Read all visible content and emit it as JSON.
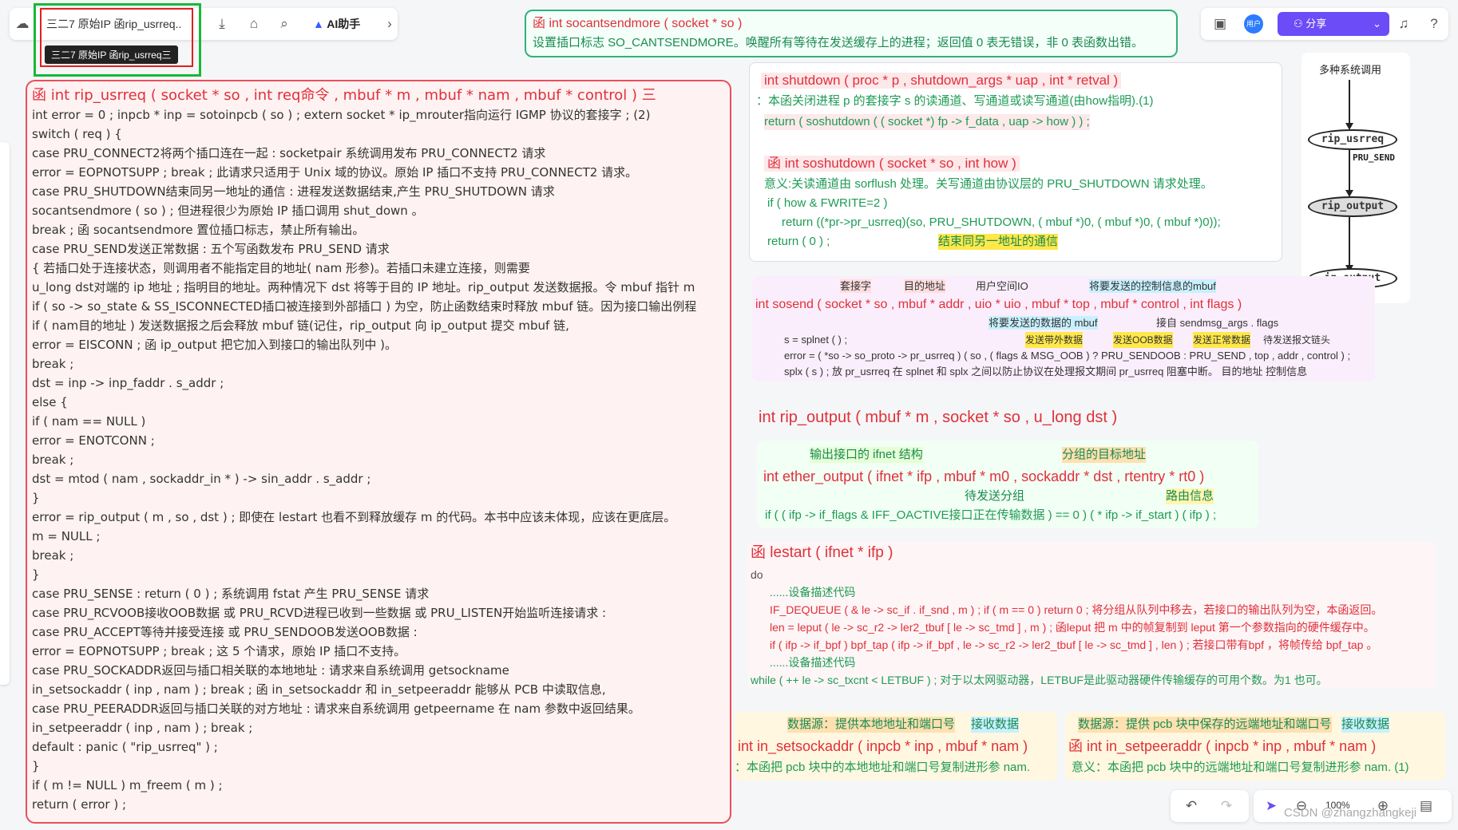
{
  "tab": {
    "title": "三二7 原始IP 函rip_usrreq..",
    "tooltip": "三二7 原始IP 函rip_usrreq三"
  },
  "toolbar": {
    "ai_label": "AI助手",
    "share_label": "分享",
    "user_label": "用户",
    "zoom": "100%"
  },
  "top_note": {
    "title": "函   int   socantsendmore ( socket * so )",
    "desc": "设置插口标志 SO_CANTSENDMORE。唤醒所有等待在发送缓存上的进程；返回值 0 表无错误，非 0 表函数出错。"
  },
  "left": {
    "lines": [
      "函     int   rip_usrreq ( socket * so , int  req命令 , mbuf *  m  , mbuf * nam , mbuf * control  )     三",
      "int error = 0 ;    inpcb * inp = sotoinpcb ( so ) ;    extern   socket *  ip_mrouter指向运行 IGMP 协议的套接字 ;    (2)",
      "switch ( req ) {",
      "case  PRU_CONNECT2将两个插口连在一起  :     socketpair 系统调用发布 PRU_CONNECT2 请求",
      "      error  =  EOPNOTSUPP ;        break ;     此请求只适用于 Unix 域的协议。原始 IP 插口不支持 PRU_CONNECT2 请求。",
      "case  PRU_SHUTDOWN结束同另一地址的通信  :      进程发送数据结束,产生 PRU_SHUTDOWN 请求",
      "      socantsendmore ( so ) ;                    但进程很少为原始 IP 插口调用 shut_down 。",
      "      break ;                                    函 socantsendmore 置位插口标志，禁止所有输出。",
      "case  PRU_SEND发送正常数据  :           五个写函数发布 PRU_SEND 请求",
      "   {                                           若插口处于连接状态，则调用者不能指定目的地址( nam 形参)。若插口未建立连接，则需要",
      "      u_long  dst对端的 ip 地址 ;                 指明目的地址。两种情况下 dst 将等于目的 IP 地址。rip_output 发送数据报。令 mbuf 指针 m",
      "      if ( so -> so_state  &  SS_ISCONNECTED插口被连接到外部插口 )       为空，防止函数结束时释放 mbuf 链。因为接口输出例程",
      "            if ( nam目的地址 )                 发送数据报之后会释放 mbuf 链(记住，rip_output 向 ip_output 提交 mbuf 链,",
      "                  error  =  EISCONN ;                                             函 ip_output 把它加入到接口的输出队列中 )。",
      "                  break ;",
      "            dst  =  inp -> inp_faddr . s_addr ;",
      "      else {",
      "            if ( nam  ==  NULL )",
      "                  error  =  ENOTCONN ;",
      "                  break ;",
      "            dst  =  mtod ( nam , sockaddr_in * ) -> sin_addr . s_addr ;",
      "      }",
      "      error  =  rip_output ( m , so , dst ) ;        即使在 lestart 也看不到释放缓存 m 的代码。本书中应该未体现，应该在更底层。",
      "      m  =  NULL ;",
      "      break ;",
      "   }",
      "case   PRU_SENSE  :       return   ( 0 ) ;              系统调用 fstat 产生 PRU_SENSE 请求",
      "case   PRU_RCVOOB接收OOB数据 或  PRU_RCVD进程已收到一些数据 或   PRU_LISTEN开始监听连接请求 :",
      "case   PRU_ACCEPT等待并接受连接 或   PRU_SENDOOB发送OOB数据 :",
      "      error  =  EOPNOTSUPP ;        break ;         这 5 个请求，原始 IP 插口不支持。",
      "case   PRU_SOCKADDR返回与插口相关联的本地地址 :        请求来自系统调用 getsockname",
      "      in_setsockaddr ( inp , nam ) ;          break ;              函 in_setsockaddr 和 in_setpeeraddr 能够从 PCB 中读取信息,",
      "case   PRU_PEERADDR返回与插口关联的对方地址 :          请求来自系统调用 getpeername     在 nam 参数中返回结果。",
      "      in_setpeeraddr ( inp , nam ) ;          break ;",
      "default :   panic ( \"rip_usrreq\" ) ;",
      "}",
      "if ( m  !=  NULL )       m_freem ( m ) ;",
      "return   ( error ) ;"
    ]
  },
  "shutdown_box": {
    "l1": "int   shutdown ( proc  * p , shutdown_args  * uap ,  int * retval )",
    "l2": "：本函关闭进程 p 的套接字 s 的读通道、写通道或读写通道(由how指明).(1)",
    "l3": "return    ( soshutdown ( ( socket *) fp -> f_data , uap -> how ) ) ;",
    "l4": "函    int   soshutdown ( socket * so , int  how )",
    "l5": "意义:关读通道由 sorflush 处理。关写通道由协议层的 PRU_SHUTDOWN 请求处理。",
    "l6": "if ( how  &   FWRITE=2 )",
    "l7": "return ((*pr->pr_usrreq)(so, PRU_SHUTDOWN,  ( mbuf *)0, ( mbuf *)0, ( mbuf *)0));",
    "l8": "return  ( 0 ) ;",
    "l9": "结束同另一地址的通信"
  },
  "diagram": {
    "title": "多种系统调用",
    "n1": "rip_usrreq",
    "label": "PRU_SEND",
    "n2": "rip_output",
    "n3": "ip_output"
  },
  "sosend_box": {
    "tags_top": [
      "套接字",
      "目的地址",
      "用户空间IO",
      "将要发送的控制信息的mbuf"
    ],
    "sig": "int    sosend ( socket * so , mbuf * addr , uio * uio , mbuf * top , mbuf * control , int  flags  )",
    "tags_mid": [
      "将要发送的数据的 mbuf",
      "接自 sendmsg_args . flags"
    ],
    "tags_small": [
      "发送带外数据",
      "发送OOB数据",
      "发送正常数据",
      "待发送报文链头"
    ],
    "l1": "s = splnet ( ) ;",
    "l2": "error = ( *so -> so_proto -> pr_usrreq ) ( so , ( flags & MSG_OOB ) ? PRU_SENDOOB : PRU_SEND , top , addr , control ) ;",
    "l3": "splx ( s ) ;          放 pr_usrreq 在 splnet 和 splx 之间以防止协议在处理报文期间 pr_usrreq 阻塞中断。    目的地址   控制信息"
  },
  "rip_output_sig": "int   rip_output ( mbuf *  m , socket *  so ,  u_long   dst )",
  "ether_box": {
    "tag1": "输出接口的 ifnet 结构",
    "tag2": "分组的目标地址",
    "sig": "int   ether_output ( ifnet * ifp , mbuf * m0 , sockaddr * dst ,  rtentry * rt0  )",
    "tag3": "待发送分组",
    "tag4": "路由信息",
    "l1": "if ( ( ifp -> if_flags  &  IFF_OACTIVE接口正在传输数据 ) == 0 )    ( * ifp -> if_start ) ( ifp ) ;"
  },
  "lestart_box": {
    "sig": "函      lestart  ( ifnet  *  ifp  )",
    "do": "do",
    "c1": "......设备描述代码",
    "l1": "IF_DEQUEUE ( & le -> sc_if . if_snd , m ) ;      if  ( m  == 0 )  return  0 ;    将分组从队列中移去，若接口的输出队列为空，本函返回。",
    "l2": "len  =  leput  ( le -> sc_r2 -> ler2_tbuf [ le -> sc_tmd ]  , m ) ;  函leput 把 m 中的帧复制到 leput 第一个参数指向的硬件缓存中。",
    "l3": "if ( ifp -> if_bpf )      bpf_tap ( ifp -> if_bpf , le -> sc_r2 -> ler2_tbuf [ le -> sc_tmd ]  , len ) ;   若接口带有bpf ，将帧传给 bpf_tap 。",
    "c2": "......设备描述代码",
    "l4": "while ( ++ le -> sc_txcnt  <  LETBUF ) ;   对于以太网驱动器，LETBUF是此驱动器硬件传输缓存的可用个数。为1 也可。"
  },
  "setsock_box": {
    "tag1": "数据源：提供本地地址和端口号",
    "tag2": "接收数据",
    "sig": "int   in_setsockaddr ( inpcb * inp ,  mbuf  * nam )",
    "desc": "：本函把 pcb 块中的本地地址和端口号复制进形参 nam."
  },
  "setpeer_box": {
    "tag1": "数据源：提供 pcb 块中保存的远端地址和端口号",
    "tag2": "接收数据",
    "sig": "函    int   in_setpeeraddr ( inpcb * inp ,  mbuf  * nam )",
    "desc": "意义：本函把 pcb 块中的远端地址和端口号复制进形参 nam.  (1)"
  },
  "watermark": "CSDN @zhangzhangkeji"
}
